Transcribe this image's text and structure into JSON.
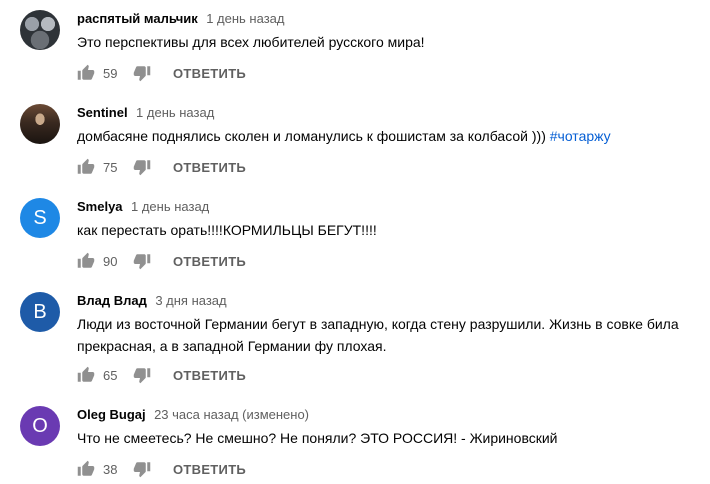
{
  "reply_label": "ОТВЕТИТЬ",
  "comments": [
    {
      "author": "распятый мальчик",
      "time": "1 день назад",
      "text": "Это перспективы для всех любителей русского мира!",
      "likes": "59",
      "avatar_type": "photo"
    },
    {
      "author": "Sentinel",
      "time": "1 день назад",
      "text": "домбасяне поднялись сколен и ломанулись к фошистам за колбасой ))) ",
      "hashtag": "#чотаржу",
      "likes": "75",
      "avatar_type": "photo"
    },
    {
      "author": "Smelya",
      "time": "1 день назад",
      "text": "как перестать орать!!!!КОРМИЛЬЦЫ БЕГУТ!!!!",
      "likes": "90",
      "avatar_letter": "S",
      "avatar_color": "#1e88e5"
    },
    {
      "author": "Влад Влад",
      "time": "3 дня назад",
      "text": "Люди из восточной Германии бегут в западную, когда стену разрушили. Жизнь в совке била прекрасная, а в западной Германии фу плохая.",
      "likes": "65",
      "avatar_letter": "B",
      "avatar_color": "#1e5ba8"
    },
    {
      "author": "Oleg Bugaj",
      "time": "23 часа назад (изменено)",
      "text": "Что не смеетесь? Не смешно? Не поняли? ЭТО РОССИЯ! - Жириновский",
      "likes": "38",
      "avatar_letter": "O",
      "avatar_color": "#6a3ab2"
    }
  ]
}
